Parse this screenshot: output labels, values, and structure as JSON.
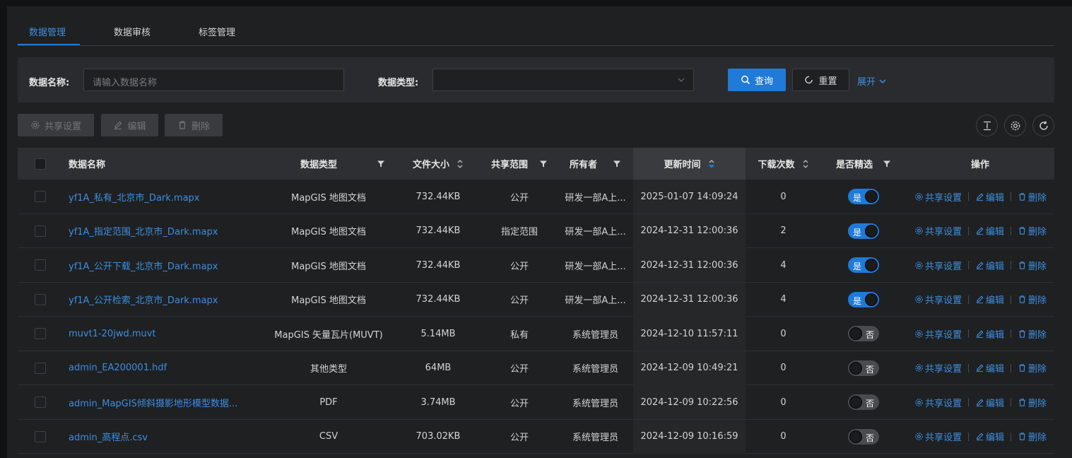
{
  "tabs": [
    {
      "label": "数据管理",
      "active": true
    },
    {
      "label": "数据审核",
      "active": false
    },
    {
      "label": "标签管理",
      "active": false
    }
  ],
  "filters": {
    "name_label": "数据名称:",
    "name_placeholder": "请输入数据名称",
    "type_label": "数据类型:",
    "type_value": "",
    "query_label": "查询",
    "reset_label": "重置",
    "expand_label": "展开"
  },
  "toolbar": {
    "share_label": "共享设置",
    "edit_label": "编辑",
    "delete_label": "删除"
  },
  "columns": {
    "name": "数据名称",
    "type": "数据类型",
    "size": "文件大小",
    "scope": "共享范围",
    "owner": "所有者",
    "updated": "更新时间",
    "downloads": "下载次数",
    "featured": "是否精选",
    "actions": "操作"
  },
  "switch_labels": {
    "on": "是",
    "off": "否"
  },
  "row_actions": {
    "share": "共享设置",
    "edit": "编辑",
    "delete": "删除"
  },
  "rows": [
    {
      "name": "yf1A_私有_北京市_Dark.mapx",
      "type": "MapGIS 地图文档",
      "size": "732.44KB",
      "scope": "公开",
      "owner": "研发一部A上...",
      "updated": "2025-01-07 14:09:24",
      "downloads": "0",
      "featured": true
    },
    {
      "name": "yf1A_指定范围_北京市_Dark.mapx",
      "type": "MapGIS 地图文档",
      "size": "732.44KB",
      "scope": "指定范围",
      "owner": "研发一部A上...",
      "updated": "2024-12-31 12:00:36",
      "downloads": "2",
      "featured": true
    },
    {
      "name": "yf1A_公开下载_北京市_Dark.mapx",
      "type": "MapGIS 地图文档",
      "size": "732.44KB",
      "scope": "公开",
      "owner": "研发一部A上...",
      "updated": "2024-12-31 12:00:36",
      "downloads": "4",
      "featured": true
    },
    {
      "name": "yf1A_公开检索_北京市_Dark.mapx",
      "type": "MapGIS 地图文档",
      "size": "732.44KB",
      "scope": "公开",
      "owner": "研发一部A上...",
      "updated": "2024-12-31 12:00:36",
      "downloads": "4",
      "featured": true
    },
    {
      "name": "muvt1-20jwd.muvt",
      "type": "MapGIS 矢量瓦片(MUVT)",
      "size": "5.14MB",
      "scope": "私有",
      "owner": "系统管理员",
      "updated": "2024-12-10 11:57:11",
      "downloads": "0",
      "featured": false
    },
    {
      "name": "admin_EA200001.hdf",
      "type": "其他类型",
      "size": "64MB",
      "scope": "公开",
      "owner": "系统管理员",
      "updated": "2024-12-09 10:49:21",
      "downloads": "0",
      "featured": false
    },
    {
      "name": "admin_MapGIS倾斜摄影地形模型数据...",
      "type": "PDF",
      "size": "3.74MB",
      "scope": "公开",
      "owner": "系统管理员",
      "updated": "2024-12-09 10:22:56",
      "downloads": "0",
      "featured": false
    },
    {
      "name": "admin_高程点.csv",
      "type": "CSV",
      "size": "703.02KB",
      "scope": "公开",
      "owner": "系统管理员",
      "updated": "2024-12-09 10:16:59",
      "downloads": "0",
      "featured": false
    }
  ],
  "colors": {
    "accent": "#1f7ad8",
    "link": "#3d8fe0",
    "background": "#1f2022"
  }
}
